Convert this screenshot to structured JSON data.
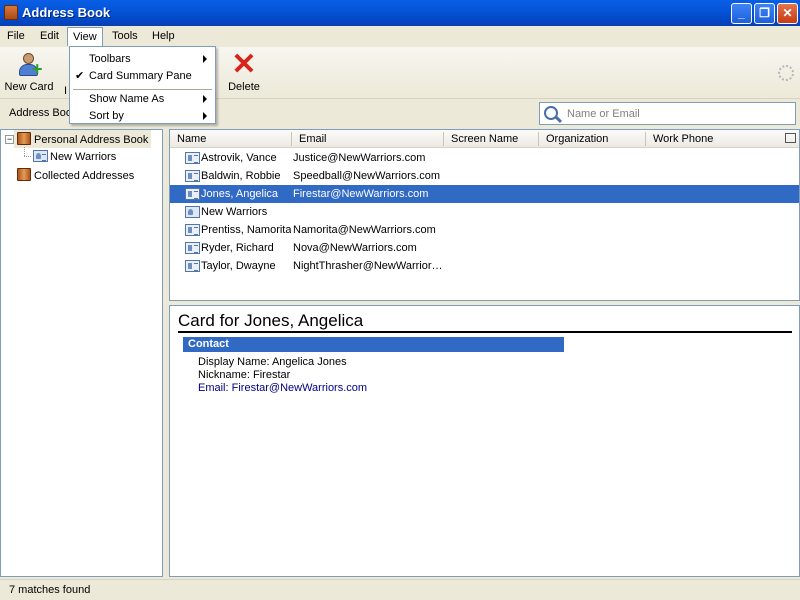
{
  "window": {
    "title": "Address Book"
  },
  "menubar": {
    "file": "File",
    "edit": "Edit",
    "view": "View",
    "tools": "Tools",
    "help": "Help"
  },
  "view_menu": {
    "items": [
      {
        "label": "Toolbars",
        "checked": false,
        "submenu": true
      },
      {
        "label": "Card Summary Pane",
        "checked": true,
        "submenu": false
      },
      {
        "label": "Show Name As",
        "checked": false,
        "submenu": true
      },
      {
        "label": "Sort by",
        "checked": false,
        "submenu": true
      }
    ]
  },
  "toolbar": {
    "new_card": "New Card",
    "partial_label": "I",
    "delete": "Delete"
  },
  "search": {
    "address_book_label": "Address Boo",
    "placeholder": "Name or Email"
  },
  "sidebar": {
    "items": [
      {
        "label": "Personal Address Book",
        "icon": "book-icon"
      },
      {
        "label": "New Warriors",
        "icon": "mailing-list-icon"
      },
      {
        "label": "Collected Addresses",
        "icon": "book-icon"
      }
    ]
  },
  "results": {
    "columns": [
      "Name",
      "Email",
      "Screen Name",
      "Organization",
      "Work Phone"
    ],
    "rows": [
      {
        "name": "Astrovik, Vance",
        "email": "Justice@NewWarriors.com",
        "type": "card"
      },
      {
        "name": "Baldwin, Robbie",
        "email": "Speedball@NewWarriors.com",
        "type": "card"
      },
      {
        "name": "Jones, Angelica",
        "email": "Firestar@NewWarriors.com",
        "type": "card",
        "selected": true
      },
      {
        "name": "New Warriors",
        "email": "",
        "type": "list"
      },
      {
        "name": "Prentiss, Namorita",
        "email": "Namorita@NewWarriors.com",
        "type": "card"
      },
      {
        "name": "Ryder, Richard",
        "email": "Nova@NewWarriors.com",
        "type": "card"
      },
      {
        "name": "Taylor, Dwayne",
        "email": "NightThrasher@NewWarrior…",
        "type": "card"
      }
    ]
  },
  "card": {
    "title": "Card for Jones, Angelica",
    "section": "Contact",
    "display_name": "Display Name: Angelica Jones",
    "nickname": "Nickname: Firestar",
    "email_label": "Email: ",
    "email_value": "Firestar@NewWarriors.com"
  },
  "status": {
    "text": "7 matches found"
  },
  "colors": {
    "selection": "#316ac5",
    "titlebar": "#0454d8",
    "window_bg": "#ece9d8"
  }
}
